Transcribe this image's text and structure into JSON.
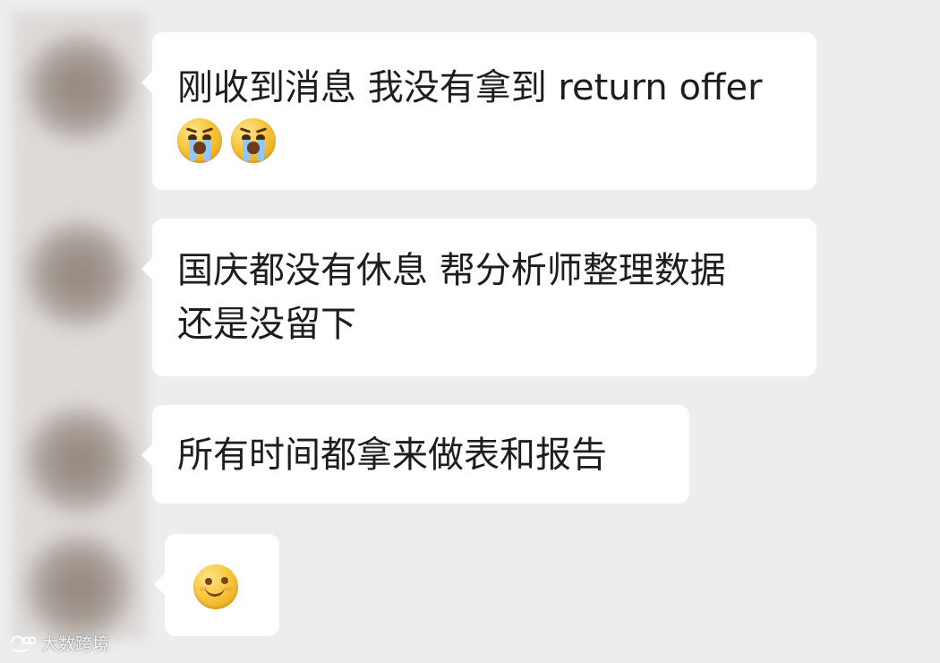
{
  "chat": {
    "messages": [
      {
        "type": "text",
        "lines": [
          "刚收到消息 我没有拿到 return offer"
        ],
        "emojis": [
          "crying-face",
          "crying-face"
        ]
      },
      {
        "type": "text",
        "lines": [
          "国庆都没有休息 帮分析师整理数据",
          "还是没留下"
        ]
      },
      {
        "type": "text",
        "lines": [
          "所有时间都拿来做表和报告"
        ]
      },
      {
        "type": "emoji",
        "emoji": "smiling-face"
      }
    ]
  },
  "watermark": {
    "text": "大数跨境",
    "icon": "brand-logo-icon"
  },
  "colors": {
    "background": "#ededed",
    "bubble": "#ffffff",
    "text": "#1d1d1d"
  }
}
